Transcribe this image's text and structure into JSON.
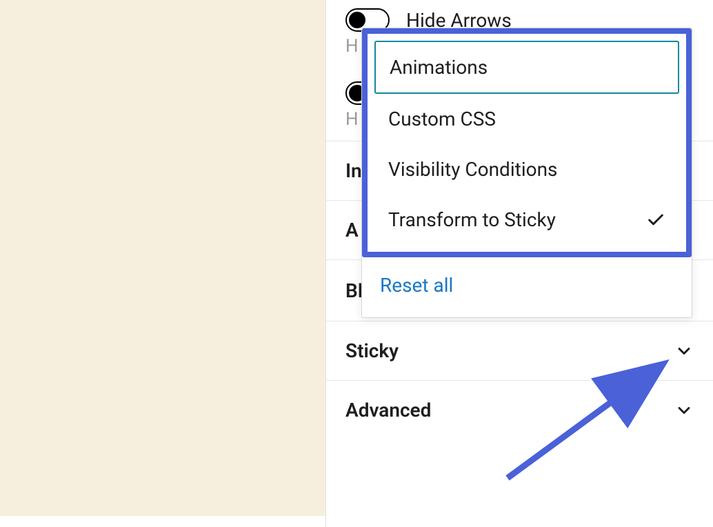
{
  "toggles": {
    "hideArrows": {
      "label": "Hide Arrows",
      "sub": "H"
    },
    "second": {
      "sub": "H"
    }
  },
  "panels": {
    "in": "In",
    "a": "A",
    "blockTools": "Block Tools",
    "sticky": "Sticky",
    "advanced": "Advanced"
  },
  "dropdown": {
    "animations": "Animations",
    "customCss": "Custom CSS",
    "visibility": "Visibility Conditions",
    "transformSticky": "Transform to Sticky",
    "resetAll": "Reset all"
  }
}
